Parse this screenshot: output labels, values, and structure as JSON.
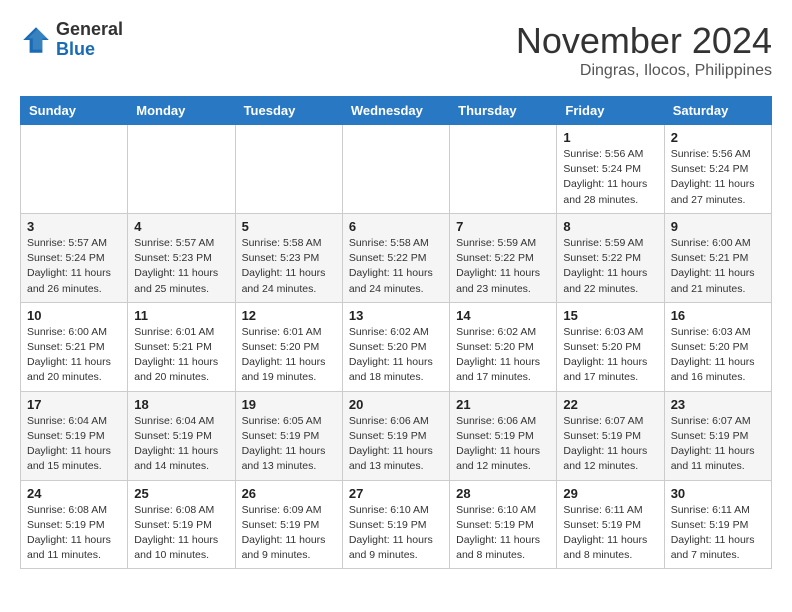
{
  "logo": {
    "general": "General",
    "blue": "Blue"
  },
  "title": {
    "month": "November 2024",
    "location": "Dingras, Ilocos, Philippines"
  },
  "weekdays": [
    "Sunday",
    "Monday",
    "Tuesday",
    "Wednesday",
    "Thursday",
    "Friday",
    "Saturday"
  ],
  "weeks": [
    [
      {
        "day": "",
        "info": ""
      },
      {
        "day": "",
        "info": ""
      },
      {
        "day": "",
        "info": ""
      },
      {
        "day": "",
        "info": ""
      },
      {
        "day": "",
        "info": ""
      },
      {
        "day": "1",
        "info": "Sunrise: 5:56 AM\nSunset: 5:24 PM\nDaylight: 11 hours\nand 28 minutes."
      },
      {
        "day": "2",
        "info": "Sunrise: 5:56 AM\nSunset: 5:24 PM\nDaylight: 11 hours\nand 27 minutes."
      }
    ],
    [
      {
        "day": "3",
        "info": "Sunrise: 5:57 AM\nSunset: 5:24 PM\nDaylight: 11 hours\nand 26 minutes."
      },
      {
        "day": "4",
        "info": "Sunrise: 5:57 AM\nSunset: 5:23 PM\nDaylight: 11 hours\nand 25 minutes."
      },
      {
        "day": "5",
        "info": "Sunrise: 5:58 AM\nSunset: 5:23 PM\nDaylight: 11 hours\nand 24 minutes."
      },
      {
        "day": "6",
        "info": "Sunrise: 5:58 AM\nSunset: 5:22 PM\nDaylight: 11 hours\nand 24 minutes."
      },
      {
        "day": "7",
        "info": "Sunrise: 5:59 AM\nSunset: 5:22 PM\nDaylight: 11 hours\nand 23 minutes."
      },
      {
        "day": "8",
        "info": "Sunrise: 5:59 AM\nSunset: 5:22 PM\nDaylight: 11 hours\nand 22 minutes."
      },
      {
        "day": "9",
        "info": "Sunrise: 6:00 AM\nSunset: 5:21 PM\nDaylight: 11 hours\nand 21 minutes."
      }
    ],
    [
      {
        "day": "10",
        "info": "Sunrise: 6:00 AM\nSunset: 5:21 PM\nDaylight: 11 hours\nand 20 minutes."
      },
      {
        "day": "11",
        "info": "Sunrise: 6:01 AM\nSunset: 5:21 PM\nDaylight: 11 hours\nand 20 minutes."
      },
      {
        "day": "12",
        "info": "Sunrise: 6:01 AM\nSunset: 5:20 PM\nDaylight: 11 hours\nand 19 minutes."
      },
      {
        "day": "13",
        "info": "Sunrise: 6:02 AM\nSunset: 5:20 PM\nDaylight: 11 hours\nand 18 minutes."
      },
      {
        "day": "14",
        "info": "Sunrise: 6:02 AM\nSunset: 5:20 PM\nDaylight: 11 hours\nand 17 minutes."
      },
      {
        "day": "15",
        "info": "Sunrise: 6:03 AM\nSunset: 5:20 PM\nDaylight: 11 hours\nand 17 minutes."
      },
      {
        "day": "16",
        "info": "Sunrise: 6:03 AM\nSunset: 5:20 PM\nDaylight: 11 hours\nand 16 minutes."
      }
    ],
    [
      {
        "day": "17",
        "info": "Sunrise: 6:04 AM\nSunset: 5:19 PM\nDaylight: 11 hours\nand 15 minutes."
      },
      {
        "day": "18",
        "info": "Sunrise: 6:04 AM\nSunset: 5:19 PM\nDaylight: 11 hours\nand 14 minutes."
      },
      {
        "day": "19",
        "info": "Sunrise: 6:05 AM\nSunset: 5:19 PM\nDaylight: 11 hours\nand 13 minutes."
      },
      {
        "day": "20",
        "info": "Sunrise: 6:06 AM\nSunset: 5:19 PM\nDaylight: 11 hours\nand 13 minutes."
      },
      {
        "day": "21",
        "info": "Sunrise: 6:06 AM\nSunset: 5:19 PM\nDaylight: 11 hours\nand 12 minutes."
      },
      {
        "day": "22",
        "info": "Sunrise: 6:07 AM\nSunset: 5:19 PM\nDaylight: 11 hours\nand 12 minutes."
      },
      {
        "day": "23",
        "info": "Sunrise: 6:07 AM\nSunset: 5:19 PM\nDaylight: 11 hours\nand 11 minutes."
      }
    ],
    [
      {
        "day": "24",
        "info": "Sunrise: 6:08 AM\nSunset: 5:19 PM\nDaylight: 11 hours\nand 11 minutes."
      },
      {
        "day": "25",
        "info": "Sunrise: 6:08 AM\nSunset: 5:19 PM\nDaylight: 11 hours\nand 10 minutes."
      },
      {
        "day": "26",
        "info": "Sunrise: 6:09 AM\nSunset: 5:19 PM\nDaylight: 11 hours\nand 9 minutes."
      },
      {
        "day": "27",
        "info": "Sunrise: 6:10 AM\nSunset: 5:19 PM\nDaylight: 11 hours\nand 9 minutes."
      },
      {
        "day": "28",
        "info": "Sunrise: 6:10 AM\nSunset: 5:19 PM\nDaylight: 11 hours\nand 8 minutes."
      },
      {
        "day": "29",
        "info": "Sunrise: 6:11 AM\nSunset: 5:19 PM\nDaylight: 11 hours\nand 8 minutes."
      },
      {
        "day": "30",
        "info": "Sunrise: 6:11 AM\nSunset: 5:19 PM\nDaylight: 11 hours\nand 7 minutes."
      }
    ]
  ]
}
